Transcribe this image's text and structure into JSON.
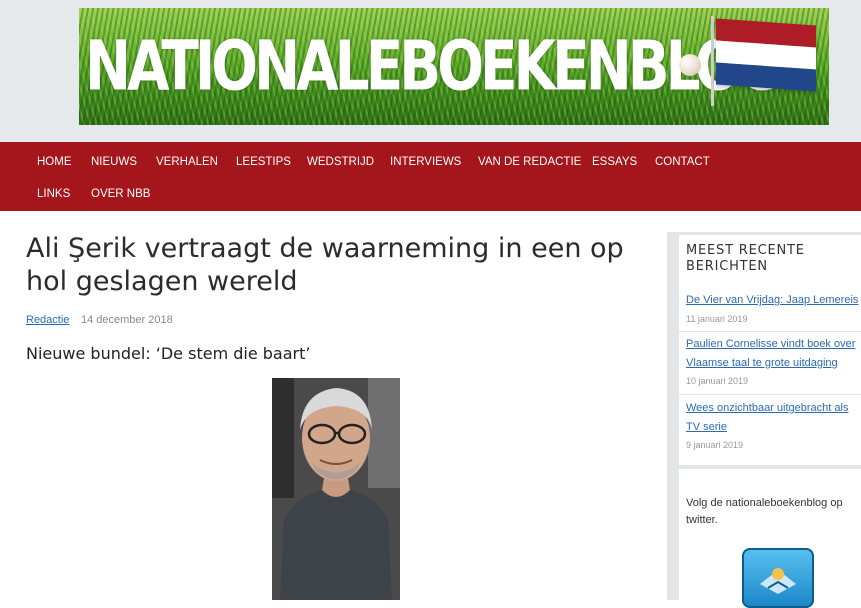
{
  "site": {
    "banner_title": "NATIONALEBOEKENBLOG",
    "flag_colors": [
      "#ae1c28",
      "#ffffff",
      "#21468b"
    ]
  },
  "nav": {
    "items": [
      {
        "label": "HOME"
      },
      {
        "label": "NIEUWS"
      },
      {
        "label": "VERHALEN"
      },
      {
        "label": "LEESTIPS"
      },
      {
        "label": "WEDSTRIJD"
      },
      {
        "label": "INTERVIEWS"
      },
      {
        "label": "VAN DE REDACTIE"
      },
      {
        "label": "ESSAYS"
      },
      {
        "label": "CONTACT"
      },
      {
        "label": "LINKS"
      },
      {
        "label": "OVER NBB"
      }
    ]
  },
  "article": {
    "title": "Ali Şerik vertraagt de waarneming in een op hol geslagen wereld",
    "author": "Redactie",
    "date": "14 december 2018",
    "subtitle": "Nieuwe bundel: ‘De stem die baart’"
  },
  "sidebar": {
    "recent_title": "MEEST RECENTE BERICHTEN",
    "posts": [
      {
        "title": "De Vier van Vrijdag: Jaap Lemereis",
        "date": "11 januari 2019"
      },
      {
        "title": "Paulien Cornelisse vindt boek over Vlaamse taal te grote uitdaging",
        "date": "10 januari 2019"
      },
      {
        "title": "Wees onzichtbaar uitgebracht als TV serie",
        "date": "9 januari 2019"
      }
    ],
    "twitter_text": "Volg de nationaleboekenblog op twitter."
  },
  "colors": {
    "nav_bg": "#a4161b",
    "link": "#2a6ab4",
    "header_bg": "#e6e9ec",
    "sidebar_bg": "#e3e6e9"
  }
}
